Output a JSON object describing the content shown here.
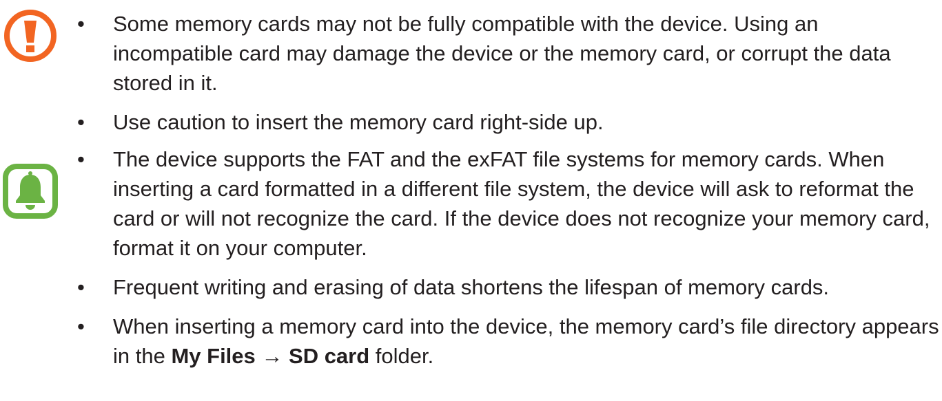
{
  "caution": {
    "icon": "caution-exclamation-icon",
    "icon_color": "#f26522",
    "items": [
      "Some memory cards may not be fully compatible with the device. Using an incompatible card may damage the device or the memory card, or corrupt the data stored in it.",
      "Use caution to insert the memory card right-side up."
    ]
  },
  "note": {
    "icon": "bell-notice-icon",
    "icon_color": "#6bb344",
    "items": [
      "The device supports the FAT and the exFAT file systems for memory cards. When inserting a card formatted in a different file system, the device will ask to reformat the card or will not recognize the card. If the device does not recognize your memory card, format it on your computer.",
      "Frequent writing and erasing of data shortens the lifespan of memory cards."
    ],
    "last_item": {
      "prefix": "When inserting a memory card into the device, the memory card’s file directory appears in the ",
      "bold_1": "My Files",
      "arrow": " → ",
      "bold_2": "SD card",
      "suffix": " folder."
    }
  },
  "bullet_glyph": "•"
}
